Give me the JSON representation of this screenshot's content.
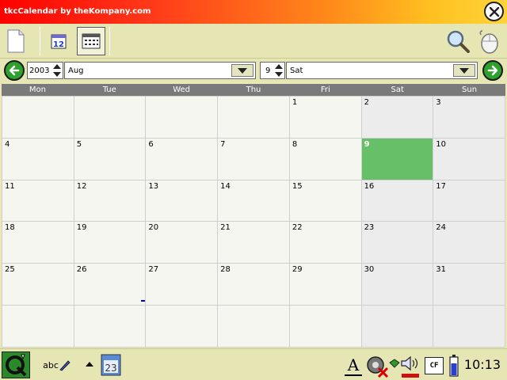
{
  "window": {
    "title": "tkcCalendar by theKompany.com"
  },
  "toolbar": {
    "buttons": [
      {
        "name": "new-event",
        "icon": "document-icon"
      },
      {
        "name": "day-view",
        "icon": "calendar-day-icon",
        "label": "12"
      },
      {
        "name": "month-view",
        "icon": "calendar-month-icon",
        "active": true
      }
    ],
    "right": [
      {
        "name": "search",
        "icon": "magnifier-icon"
      },
      {
        "name": "mouse",
        "icon": "mouse-icon"
      }
    ]
  },
  "nav": {
    "year": "2003",
    "month": "Aug",
    "day": "9",
    "weekday": "Sat"
  },
  "calendar": {
    "weekdays": [
      "Mon",
      "Tue",
      "Wed",
      "Thu",
      "Fri",
      "Sat",
      "Sun"
    ],
    "weeks": [
      [
        "",
        "",
        "",
        "",
        "1",
        "2",
        "3"
      ],
      [
        "4",
        "5",
        "6",
        "7",
        "8",
        "9",
        "10"
      ],
      [
        "11",
        "12",
        "13",
        "14",
        "15",
        "16",
        "17"
      ],
      [
        "18",
        "19",
        "20",
        "21",
        "22",
        "23",
        "24"
      ],
      [
        "25",
        "26",
        "27",
        "28",
        "29",
        "30",
        "31"
      ],
      [
        "",
        "",
        "",
        "",
        "",
        "",
        ""
      ]
    ],
    "today": "9",
    "today_color": "#67c068",
    "weekend_color": "#ececec"
  },
  "taskbar": {
    "clock": "10:13",
    "input_method_label": "abc",
    "tray": [
      "font-icon",
      "network-disconnected-icon",
      "volume-icon",
      "cf-card-icon",
      "battery-icon"
    ],
    "cf_label": "CF",
    "font_label": "A"
  }
}
